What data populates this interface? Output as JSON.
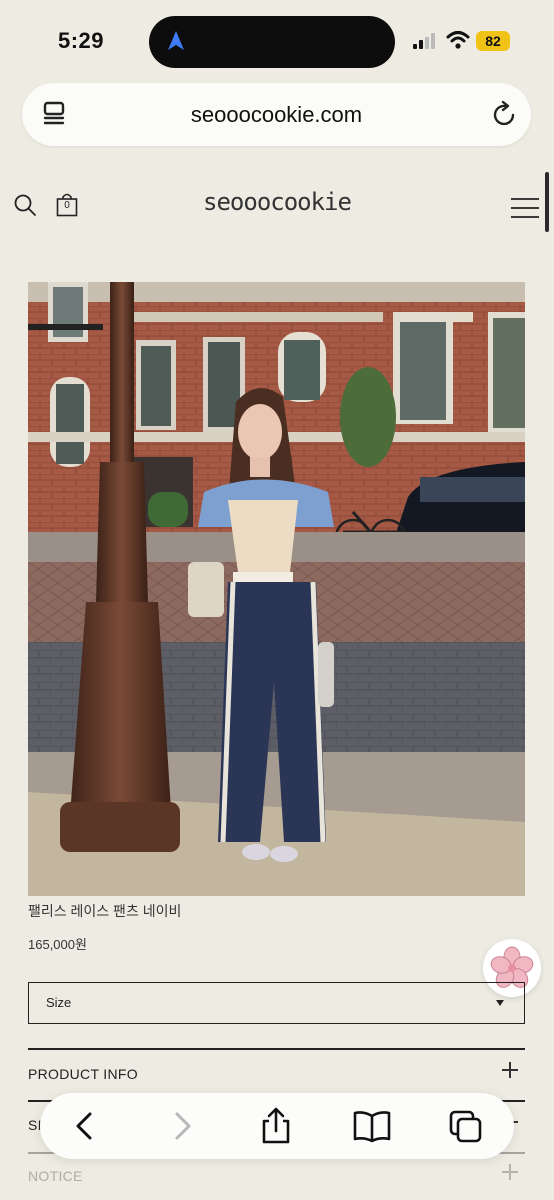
{
  "status_bar": {
    "time": "5:29",
    "battery": "82"
  },
  "browser": {
    "url": "seooocookie.com"
  },
  "site": {
    "logo": "seooocookie",
    "cart_count": "0"
  },
  "product": {
    "name": "팰리스 레이스 팬츠 네이비",
    "price": "165,000원",
    "size_select": {
      "selected": "Size"
    }
  },
  "accordion": {
    "items": [
      {
        "label": "PRODUCT INFO"
      },
      {
        "label": "SIZE INFO"
      },
      {
        "label": "NOTICE"
      }
    ]
  },
  "icons": {
    "status": [
      "location-arrow-icon",
      "signal-icon",
      "wifi-icon",
      "battery-icon"
    ],
    "browser": [
      "tab-icon",
      "reload-icon"
    ],
    "header": [
      "search-icon",
      "bag-icon",
      "menu-icon"
    ],
    "toolbar": [
      "back-icon",
      "forward-icon",
      "share-icon",
      "bookmarks-icon",
      "tabs-icon"
    ],
    "floating": [
      "flower-icon"
    ]
  }
}
